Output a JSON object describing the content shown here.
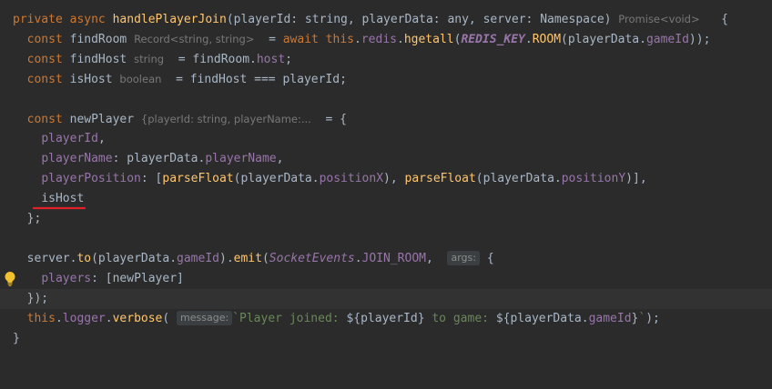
{
  "colors": {
    "background": "#2b2b2b",
    "keyword": "#cc7832",
    "function": "#ffc66d",
    "property": "#9876aa",
    "string": "#6a8759",
    "text": "#a9b7c6",
    "hint": "#787878",
    "error_underline": "#e0212a",
    "bulb": "#f2c12e"
  },
  "icons": {
    "bulb": "intention-bulb-icon"
  },
  "code": {
    "l1": {
      "private": "private",
      "async": "async",
      "fn": "handlePlayerJoin",
      "params": "(playerId: string, playerData: any, server: Namespace)",
      "hint": "Promise<void>",
      "brace": "{"
    },
    "l2": {
      "const": "const",
      "var": "findRoom",
      "hint": "Record<string, string>",
      "eq": "=",
      "await": "await",
      "this": "this",
      "dot1": ".",
      "redis": "redis",
      "dot2": ".",
      "hgetall": "hgetall",
      "open": "(",
      "key": "REDIS_KEY",
      "dot3": ".",
      "room": "ROOM",
      "args": "(playerData.",
      "gameId": "gameId",
      "close": "));"
    },
    "l3": {
      "const": "const",
      "var": "findHost",
      "hint": "string",
      "rest": "= findRoom.",
      "host": "host",
      "end": ";"
    },
    "l4": {
      "const": "const",
      "var": "isHost",
      "hint": "boolean",
      "rest": "= findHost === playerId;"
    },
    "l6": {
      "const": "const",
      "var": "newPlayer",
      "hint": "{playerId: string, playerName:...",
      "rest": "= {"
    },
    "l7": {
      "text": "playerId",
      "comma": ","
    },
    "l8": {
      "key": "playerName",
      "mid": ": playerData.",
      "val": "playerName",
      "comma": ","
    },
    "l9": {
      "key": "playerPosition",
      "a": ": [",
      "pf1": "parseFloat",
      "b": "(playerData.",
      "px": "positionX",
      "c": "), ",
      "pf2": "parseFloat",
      "d": "(playerData.",
      "py": "positionY",
      "e": ")],"
    },
    "l10": {
      "text": "isHost"
    },
    "l11": {
      "text": "};"
    },
    "l13": {
      "server": "server.",
      "to": "to",
      "a": "(playerData.",
      "gameId": "gameId",
      "b": ").",
      "emit": "emit",
      "c": "(",
      "cls": "SocketEvents",
      "d": ".",
      "event": "JOIN_ROOM",
      "e": ",",
      "hint": "args:",
      "f": "{"
    },
    "l14": {
      "key": "players",
      "rest": ": [newPlayer]"
    },
    "l15": {
      "text": "});"
    },
    "l16": {
      "this": "this",
      "a": ".",
      "logger": "logger",
      "b": ".",
      "verbose": "verbose",
      "c": "(",
      "hint": "message:",
      "tick": "`",
      "s1": "Player joined: ",
      "i1": "${playerId}",
      "s2": " to game: ",
      "i2": "${playerData.",
      "gid": "gameId",
      "i3": "}",
      "tick2": "`",
      "end": ");"
    },
    "l17": {
      "text": "}"
    }
  }
}
